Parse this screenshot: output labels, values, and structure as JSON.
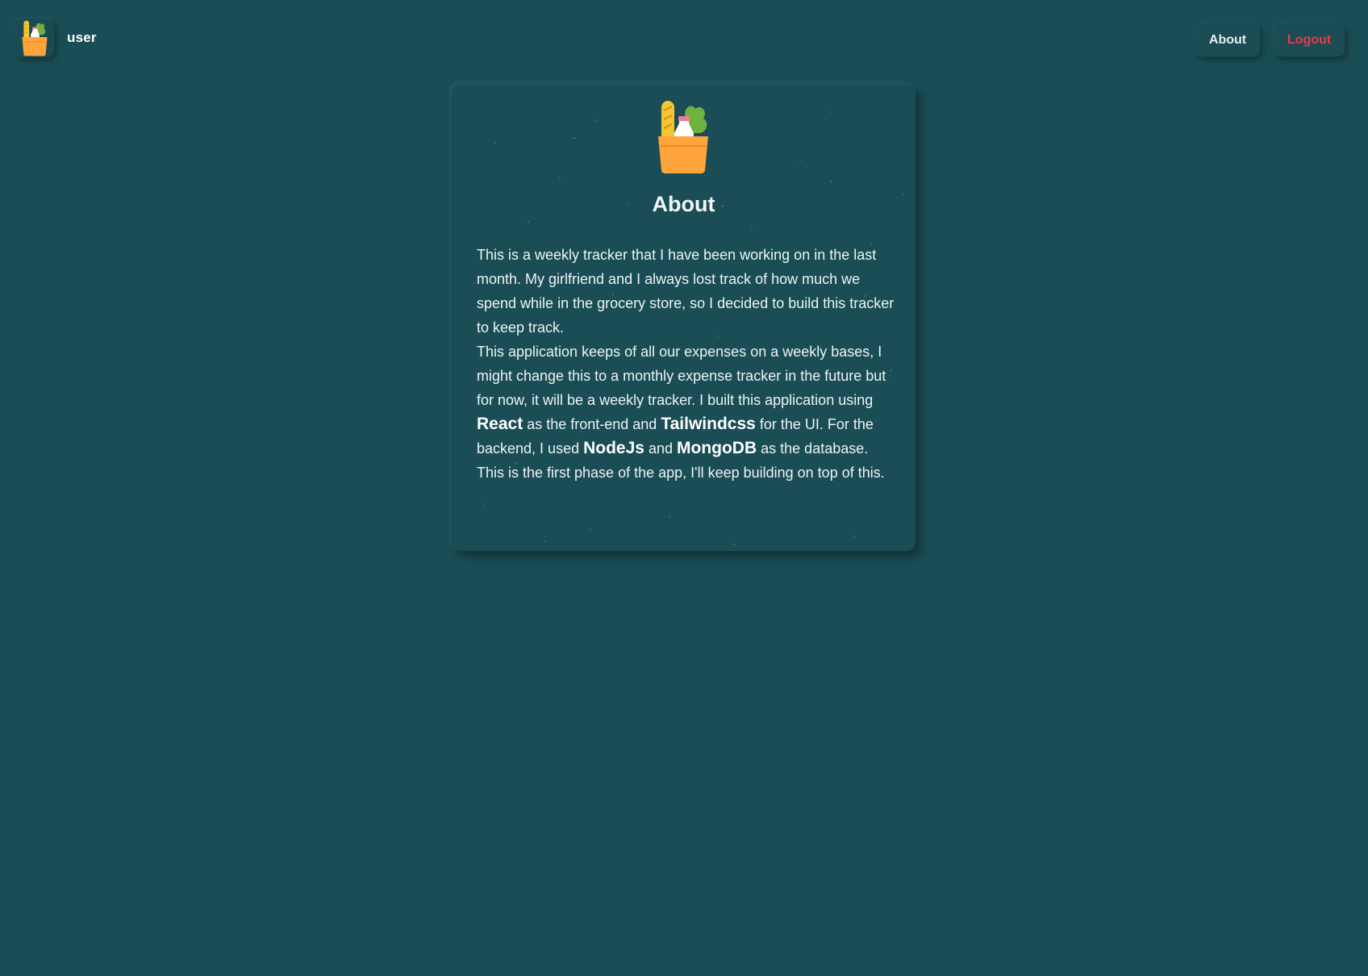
{
  "header": {
    "user_label": "user",
    "logo_icon": "grocery-bag-icon"
  },
  "nav": {
    "about_label": "About",
    "logout_label": "Logout"
  },
  "card": {
    "logo_icon": "grocery-bag-icon",
    "title": "About",
    "paragraph1": "This is a weekly tracker that I have been working on in the last month. My girlfriend and I always lost track of how much we spend while in the grocery store, so I decided to build this tracker to keep track.",
    "p2_intro": "This application keeps of all our expenses on a weekly bases, I might change this to a monthly expense tracker in the future but for now, it will be a weekly tracker. I built this application using ",
    "tech_react": "React",
    "p2_mid1": " as the front-end and ",
    "tech_tailwind": "Tailwindcss",
    "p2_mid2": " for the UI. For the backend, I used ",
    "tech_node": "NodeJs",
    "p2_mid3": " and ",
    "tech_mongo": "MongoDB",
    "p2_end": " as the database. This is the first phase of the app, I'll keep building on top of this."
  },
  "colors": {
    "background": "#1a4e56",
    "card": "#1a4d55",
    "logout_text": "#ee3b44",
    "bag_orange": "#ffa53c",
    "lettuce_green": "#6fb23f",
    "baguette_yellow": "#f6c532"
  }
}
